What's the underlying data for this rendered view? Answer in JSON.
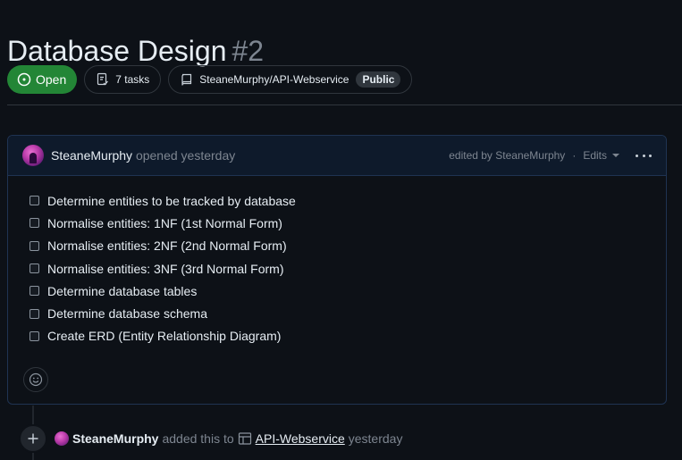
{
  "issue": {
    "title": "Database Design",
    "number": "#2",
    "state": "Open",
    "tasks": "7 tasks",
    "repo": "SteaneMurphy/API-Webservice",
    "visibility": "Public"
  },
  "comment": {
    "author": "SteaneMurphy",
    "action": "opened yesterday",
    "edited_by": "edited by SteaneMurphy",
    "separator": "·",
    "edits_label": "Edits",
    "tasks": [
      "Determine entities to be tracked by database",
      "Normalise entities: 1NF (1st Normal Form)",
      "Normalise entities: 2NF (2nd Normal Form)",
      "Normalise entities: 3NF (3rd Normal Form)",
      "Determine database tables",
      "Determine database schema",
      "Create ERD (Entity Relationship Diagram)"
    ]
  },
  "timeline": {
    "actor": "SteaneMurphy",
    "action": "added this to",
    "project": "API-Webservice",
    "time": "yesterday"
  },
  "colors": {
    "open_green": "#238636",
    "background": "#0d1117",
    "muted": "#7d8590",
    "header_bg": "#0e1a2b"
  },
  "icons": {
    "state": "issue-opened-icon",
    "tasks": "checklist-icon",
    "repo": "repo-icon",
    "react": "smiley-icon",
    "timeline": "plus-icon",
    "project": "table-icon"
  }
}
